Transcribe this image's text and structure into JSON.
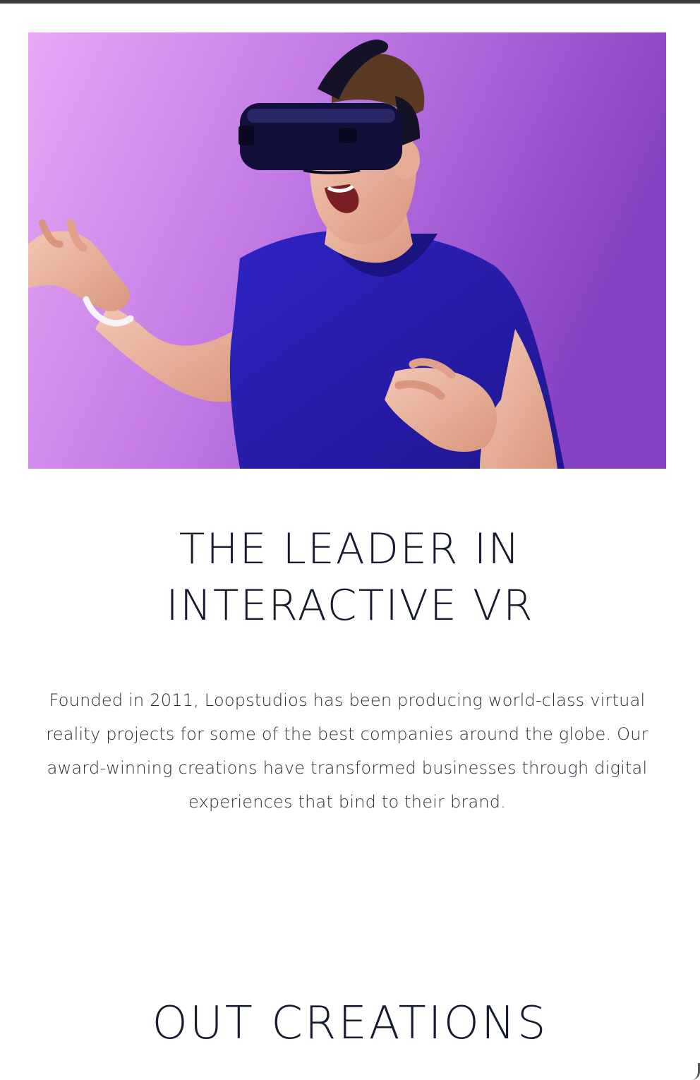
{
  "hero": {
    "image_alt": "Man wearing a VR headset reaching out with both hands against a purple background"
  },
  "intro_section": {
    "headline_line1": "THE LEADER IN",
    "headline_line2": "INTERACTIVE VR",
    "body": "Founded in 2011, Loopstudios has been producing world-class virtual reality projects for some of the best companies around the globe. Our award-winning creations have transformed businesses through digital experiences that bind to their brand."
  },
  "creations_section": {
    "title": "OUT CREATIONS"
  },
  "colors": {
    "text_dark": "#161b2e",
    "hero_purple": "#b063dc",
    "shirt_blue": "#2a1fb0"
  }
}
